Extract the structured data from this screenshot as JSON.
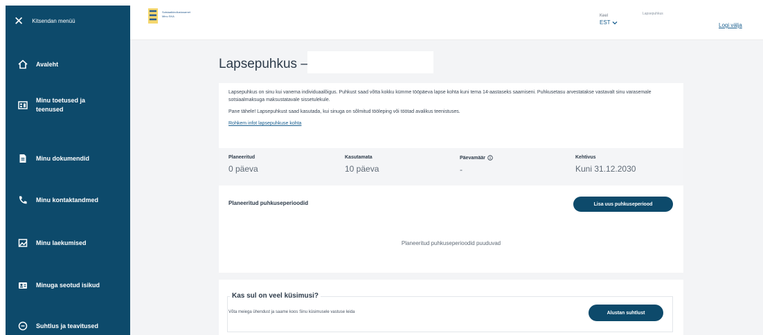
{
  "sidebar": {
    "close_label": "Kitsendan menüü",
    "items": [
      {
        "label": "Avaleht",
        "icon": "home-icon"
      },
      {
        "label": "Minu toetused ja teenused",
        "icon": "benefits-icon"
      },
      {
        "label": "Minu dokumendid",
        "icon": "document-icon"
      },
      {
        "label": "Minu kontaktandmed",
        "icon": "phone-icon"
      },
      {
        "label": "Minu laekumised",
        "icon": "payments-icon"
      },
      {
        "label": "Minuga seotud isikud",
        "icon": "people-icon"
      },
      {
        "label": "Suhtlus ja teavitused",
        "icon": "chat-icon"
      }
    ]
  },
  "header": {
    "logo_line1": "Sotsiaalkindlustusamet",
    "logo_line2": "Minu SKA",
    "lang_caption": "Keel",
    "lang_value": "EST",
    "user_name": "Lapsepuhkus",
    "logout": "Logi välja"
  },
  "page": {
    "title": "Lapsepuhkus –",
    "intro1": "Lapsepuhkus on sinu kui vanema individuaalõigus. Puhkust saad võtta kokku kümme tööpäeva lapse kohta kuni tema 14-aastaseks saamiseni. Puhkusetasu arvestatakse vastavalt sinu varasemale sotsiaalmaksuga maksustatavale sissetulekule.",
    "intro2": "Pane tähele! Lapsepuhkust saad kasutada, kui sinuga on sõlmitud tööleping või töötad avalikus teenistuses.",
    "more_link": "Rohkem infot lapsepuhkuse kohta",
    "stats": [
      {
        "label": "Planeeritud",
        "value": "0 päeva"
      },
      {
        "label": "Kasutamata",
        "value": "10 päeva"
      },
      {
        "label": "Päevamäär",
        "value": "-"
      },
      {
        "label": "Kehtivus",
        "value": "Kuni 31.12.2030"
      }
    ],
    "planned_title": "Planeeritud puhkuseperioodid",
    "add_button": "Lisa uus puhkuseperiood",
    "empty_text": "Planeeritud puhkuseperioodid puuduvad"
  },
  "questions": {
    "title": "Kas sul on veel küsimusi?",
    "text": "Võta meiega ühendust ja saame koos Sinu küsimusele vastuse leida",
    "button": "Alustan suhtlust"
  },
  "colors": {
    "sidebar_bg": "#0d4a6b",
    "accent": "#1a5f8f",
    "page_bg": "#f3f4f6"
  }
}
